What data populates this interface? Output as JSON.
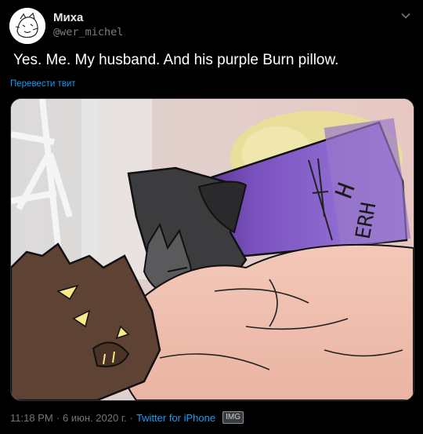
{
  "user": {
    "display_name": "Миха",
    "handle": "@wer_michel"
  },
  "tweet": {
    "text": "Yes. Me. My husband. And his purple Burn pillow.",
    "translate_label": "Перевести твит"
  },
  "meta": {
    "time": "11:18 PM",
    "separator1": "·",
    "date": "6 июн. 2020 г.",
    "separator2": "·",
    "source": "Twitter for iPhone",
    "badge": "IMG"
  },
  "colors": {
    "background": "#000000",
    "link": "#1d9bf0",
    "muted": "#71767b",
    "pillow_purple": "#8a5fd0"
  },
  "icons": {
    "menu": "chevron-down-icon",
    "avatar": "avatar-doodle"
  }
}
